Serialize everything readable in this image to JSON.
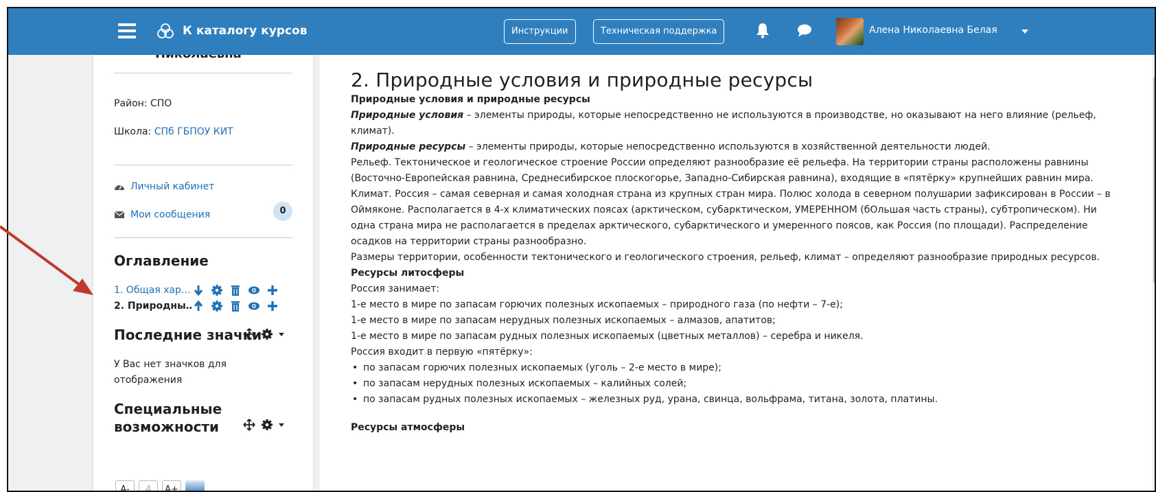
{
  "navbar": {
    "catalog_label": "К каталогу курсов",
    "instructions_label": "Инструкции",
    "support_label": "Техническая поддержка",
    "user_name": "Алена Николаевна Белая"
  },
  "sidebar": {
    "name_tail": "Николаевна",
    "district": "Район: СПО",
    "school_label": "Школа:",
    "school_value": "СПб ГБПОУ КИТ",
    "cabinet": "Личный кабинет",
    "messages": "Мои сообщения",
    "messages_count": "0",
    "toc_heading": "Оглавление",
    "toc": [
      {
        "label": "1. Общая хар…",
        "move": "down"
      },
      {
        "label": "2. Природны…",
        "move": "up"
      }
    ],
    "badges_heading": "Последние значки",
    "badges_empty": "У Вас нет значков для отображения",
    "access_heading_1": "Специальные",
    "access_heading_2": "возможности",
    "font_buttons": [
      "A-",
      "A",
      "A+"
    ]
  },
  "main": {
    "title": "2. Природные условия и природные ресурсы",
    "subtitle": "Природные условия и природные ресурсы",
    "cond_term": "Природные условия",
    "cond_text": " – элементы природы, которые непосредственно не используются в производстве, но оказывают на него влияние (рельеф, климат).",
    "res_term": "Природные ресурсы",
    "res_text": " – элементы природы, которые непосредственно используются в хозяйственной деятельности людей.",
    "relief": "Рельеф. Тектоническое и геологическое строение России определяют разнообразие её рельефа. На территории страны расположены равнины (Восточно-Европейская равнина, Среднесибирское плоскогорье, Западно-Сибирская равнина), входящие в «пятёрку» крупнейших равнин мира.",
    "climate": "Климат. Россия – самая северная и самая холодная страна из крупных стран мира. Полюс холода в северном полушарии зафиксирован в России – в Оймяконе. Располагается в 4-х климатических поясах (арктическом, субарктическом, УМЕРЕННОМ (бОльшая часть страны), субтропическом). Ни одна страна мира не располагается в пределах арктического, субарктического и умеренного поясов, как Россия (по площади). Распределение осадков на территории страны разнообразно.",
    "sizes": "Размеры территории, особенности тектонического и геологического строения, рельеф, климат – определяют разнообразие природных ресурсов.",
    "litho_heading": "Ресурсы литосферы",
    "litho_intro": "Россия занимает:",
    "places": [
      "1-е место в мире по запасам горючих полезных ископаемых – природного газа (по нефти – 7-е);",
      "1-е место в мире по запасам нерудных полезных ископаемых – алмазов, апатитов;",
      "1-е место в мире по запасам рудных полезных ископаемых (цветных металлов) – серебра и никеля."
    ],
    "top5_intro": "Россия входит в первую «пятёрку»:",
    "top5": [
      "по запасам горючих полезных ископаемых (уголь – 2-е место в мире);",
      "по запасам нерудных полезных ископаемых – калийных солей;",
      "по запасам рудных полезных ископаемых – железных руд, урана, свинца, вольфрама, титана, золота, платины."
    ],
    "atmo_heading": "Ресурсы атмосферы"
  }
}
